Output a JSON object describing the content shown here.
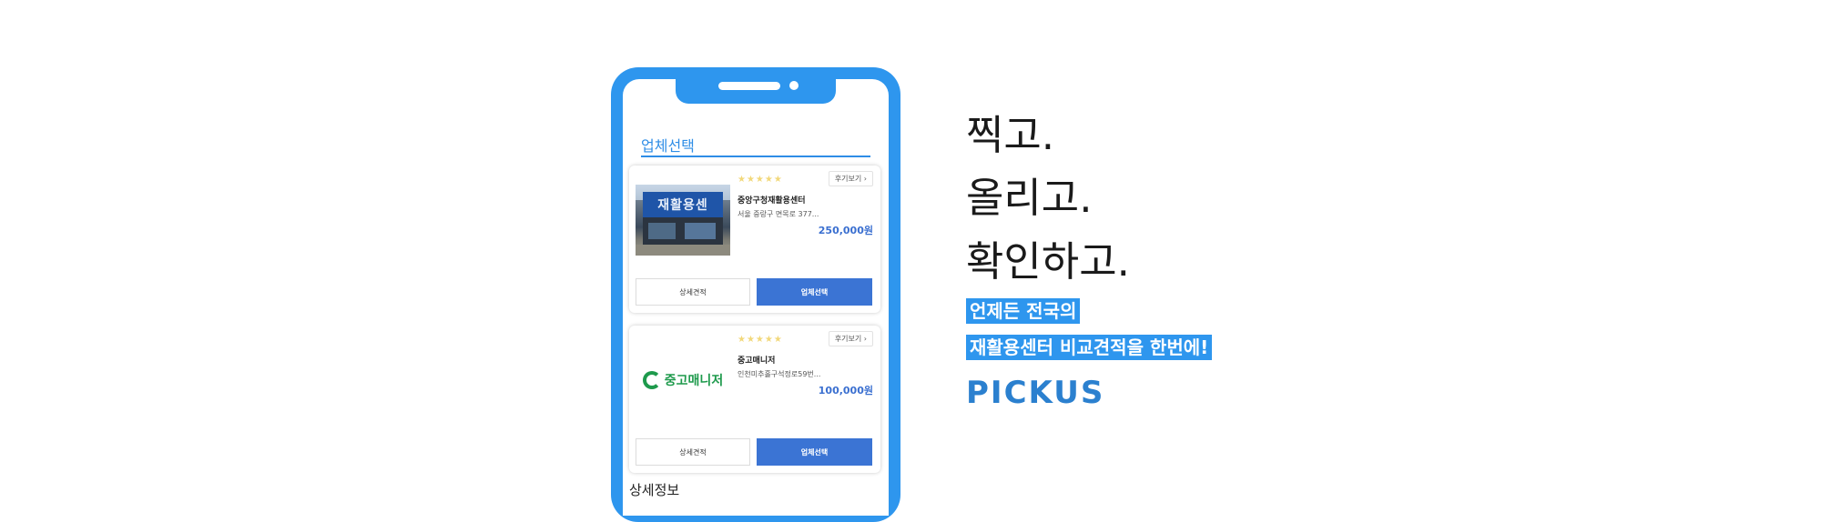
{
  "phone": {
    "section_title": "업체선택",
    "detail_info": "상세정보",
    "cards": [
      {
        "stars": "★★★★★",
        "review_button": "후기보기 ›",
        "name": "중앙구청재활용센터",
        "address": "서울 중랑구 면목로 377...",
        "price": "250,000원",
        "detail_button": "상세견적",
        "select_button": "업체선택",
        "thumb_sign": "재활용센"
      },
      {
        "stars": "★★★★★",
        "review_button": "후기보기 ›",
        "name": "중고매니저",
        "address": "인천미추홀구석정로59번...",
        "price": "100,000원",
        "detail_button": "상세견적",
        "select_button": "업체선택",
        "logo_text": "중고매니저"
      }
    ]
  },
  "headline": {
    "line1": "찍고.",
    "line2": "올리고.",
    "line3": "확인하고."
  },
  "highlight": {
    "line1": "언제든 전국의",
    "line2": "재활용센터 비교견적을 한번에!"
  },
  "brand": "PICKUS",
  "colors": {
    "accent": "#2e96ee",
    "button": "#3b74d4",
    "star": "#f2d87a",
    "logo_green": "#1e9a4c"
  }
}
